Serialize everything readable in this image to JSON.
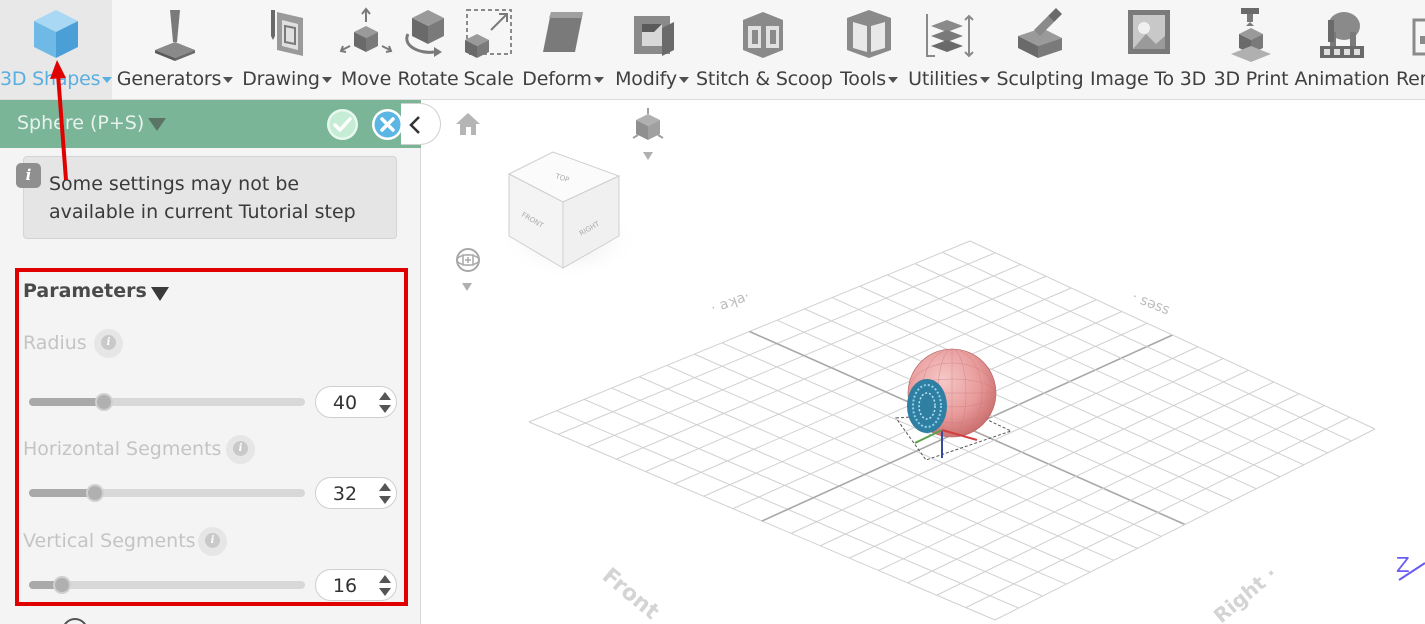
{
  "toolbar": {
    "items": [
      {
        "label": "3D Shapes",
        "icon": "cube-icon",
        "dropdown": true,
        "active": true
      },
      {
        "label": "Generators",
        "icon": "generator-icon",
        "dropdown": true
      },
      {
        "label": "Drawing",
        "icon": "drawing-icon",
        "dropdown": true
      },
      {
        "label": "Move",
        "icon": "move-icon",
        "dropdown": false
      },
      {
        "label": "Rotate",
        "icon": "rotate-icon",
        "dropdown": false
      },
      {
        "label": "Scale",
        "icon": "scale-icon",
        "dropdown": false
      },
      {
        "label": "Deform",
        "icon": "deform-icon",
        "dropdown": true
      },
      {
        "label": "Modify",
        "icon": "modify-icon",
        "dropdown": true
      },
      {
        "label": "Stitch & Scoop",
        "icon": "stitch-scoop-icon",
        "dropdown": false
      },
      {
        "label": "Tools",
        "icon": "tools-icon",
        "dropdown": true
      },
      {
        "label": "Utilities",
        "icon": "utilities-icon",
        "dropdown": true
      },
      {
        "label": "Sculpting",
        "icon": "sculpting-icon",
        "dropdown": false
      },
      {
        "label": "Image To 3D",
        "icon": "image-to-3d-icon",
        "dropdown": false
      },
      {
        "label": "3D Print",
        "icon": "3d-print-icon",
        "dropdown": false
      },
      {
        "label": "Animation",
        "icon": "animation-icon",
        "dropdown": false
      },
      {
        "label": "Ren",
        "icon": "render-icon",
        "dropdown": false
      }
    ]
  },
  "panel": {
    "title": "Sphere (P+S)",
    "info_icon": "i",
    "info_text": "Some settings may not be available in current Tutorial step",
    "parameters_title": "Parameters",
    "params": [
      {
        "label": "Radius",
        "value": "40",
        "fraction": 0.27
      },
      {
        "label": "Horizontal Segments",
        "value": "32",
        "fraction": 0.24
      },
      {
        "label": "Vertical Segments",
        "value": "16",
        "fraction": 0.12
      }
    ]
  },
  "viewport": {
    "cube_faces": {
      "top": "TOP",
      "front": "FRONT",
      "right": "RIGHT"
    },
    "axis_label": "Z",
    "colors": {
      "sphere": "#e89a9a",
      "detail": "#3a8fb0",
      "grid": "#d0d0d0"
    }
  },
  "colors": {
    "accent": "#5aaee0",
    "panel_header": "#7ab598",
    "highlight": "#e00000"
  }
}
